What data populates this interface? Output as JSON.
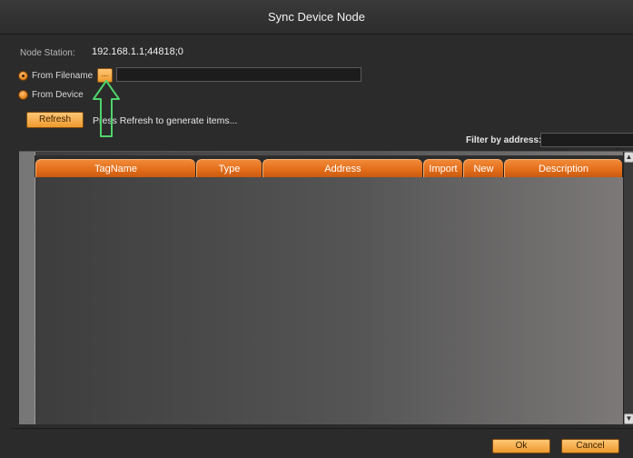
{
  "window": {
    "title": "Sync Device Node"
  },
  "node_station": {
    "label": "Node Station:",
    "value": "192.168.1.1;44818;0"
  },
  "source": {
    "from_filename": {
      "label": "From Filename",
      "checked": true,
      "browse_label": "...",
      "path_value": ""
    },
    "from_device": {
      "label": "From Device",
      "checked": false
    }
  },
  "refresh": {
    "button_label": "Refresh",
    "hint": "Press Refresh to generate items..."
  },
  "filter": {
    "label": "Filter by address:",
    "value": ""
  },
  "grid": {
    "columns": [
      {
        "label": "TagName"
      },
      {
        "label": "Type"
      },
      {
        "label": "Address"
      },
      {
        "label": "Import"
      },
      {
        "label": "New"
      },
      {
        "label": "Description"
      }
    ],
    "rows": []
  },
  "footer": {
    "ok_label": "Ok",
    "cancel_label": "Cancel"
  },
  "colors": {
    "accent": "#e8781f",
    "annotation_arrow": "#4fd36b"
  },
  "icons": {
    "scroll_up": "chevron-up-icon",
    "scroll_down": "chevron-down-icon",
    "annotation": "up-arrow-icon"
  }
}
